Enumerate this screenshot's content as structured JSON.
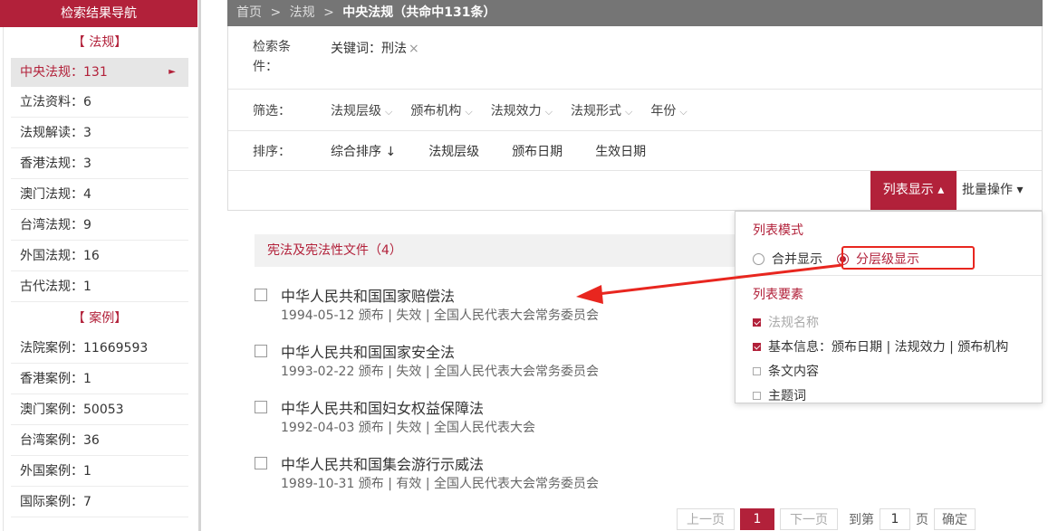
{
  "sidebar": {
    "header": "检索结果导航",
    "section_law": "【 法规】",
    "law_items": [
      {
        "label": "中央法规：131",
        "active": true
      },
      {
        "label": "立法资料：6"
      },
      {
        "label": "法规解读：3"
      },
      {
        "label": "香港法规：3"
      },
      {
        "label": "澳门法规：4"
      },
      {
        "label": "台湾法规：9"
      },
      {
        "label": "外国法规：16"
      },
      {
        "label": "古代法规：1"
      }
    ],
    "section_case": "【 案例】",
    "case_items": [
      {
        "label": "法院案例：11669593"
      },
      {
        "label": "香港案例：1"
      },
      {
        "label": "澳门案例：50053"
      },
      {
        "label": "台湾案例：36"
      },
      {
        "label": "外国案例：1"
      },
      {
        "label": "国际案例：7"
      }
    ],
    "active_arrow": "►"
  },
  "breadcrumb": {
    "home": "首页",
    "sep": ">",
    "level1": "法规",
    "current": "中央法规（共命中131条）"
  },
  "conditions": {
    "label": "检索条件：",
    "keyword": "关键词：刑法",
    "remove": "×"
  },
  "filter": {
    "label": "筛选：",
    "items": [
      "法规层级",
      "颁布机构",
      "法规效力",
      "法规形式",
      "年份"
    ]
  },
  "sort": {
    "label": "排序：",
    "items": [
      "综合排序 ↓",
      "法规层级",
      "颁布日期",
      "生效日期"
    ]
  },
  "actions": {
    "list_display": "列表显示 ▴",
    "batch": "批量操作 ▾"
  },
  "group": {
    "title": "宪法及宪法性文件（4）"
  },
  "results": [
    {
      "title": "中华人民共和国国家赔偿法",
      "meta": "1994-05-12 颁布 | 失效 | 全国人民代表大会常务委员会"
    },
    {
      "title": "中华人民共和国国家安全法",
      "meta": "1993-02-22 颁布 | 失效 | 全国人民代表大会常务委员会"
    },
    {
      "title": "中华人民共和国妇女权益保障法",
      "meta": "1992-04-03 颁布 | 失效 | 全国人民代表大会"
    },
    {
      "title": "中华人民共和国集会游行示威法",
      "meta": "1989-10-31 颁布 | 有效 | 全国人民代表大会常务委员会"
    }
  ],
  "dropdown": {
    "mode_title": "列表模式",
    "merge": "合并显示",
    "hierarchy": "分层级显示",
    "elements_title": "列表要素",
    "elements": [
      {
        "label": "法规名称",
        "checked": true,
        "dim": true
      },
      {
        "label": "基本信息：颁布日期 | 法规效力 | 颁布机构",
        "checked": true
      },
      {
        "label": "条文内容",
        "checked": false
      },
      {
        "label": "主题词",
        "checked": false
      }
    ]
  },
  "pager": {
    "prev": "上一页",
    "current": "1",
    "next": "下一页",
    "goto": "到第",
    "page_value": "1",
    "page_unit": "页",
    "ok": "确定"
  },
  "colors": {
    "brand": "#b2213a",
    "annotation": "#e8261f"
  }
}
